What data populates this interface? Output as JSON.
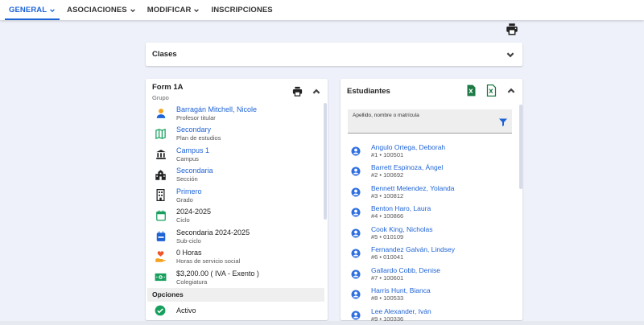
{
  "nav": {
    "tabs": [
      {
        "label": "GENERAL",
        "dropdown": true,
        "active": true
      },
      {
        "label": "ASOCIACIONES",
        "dropdown": true
      },
      {
        "label": "MODIFICAR",
        "dropdown": true
      },
      {
        "label": "INSCRIPCIONES",
        "dropdown": false
      }
    ]
  },
  "clases": {
    "title": "Clases"
  },
  "group": {
    "title": "Form 1A",
    "subtitle": "Grupo",
    "items": [
      {
        "value": "Barragán Mitchell, Nicole",
        "label": "Profesor titular",
        "icon": "person-icon",
        "link": true
      },
      {
        "value": "Secondary",
        "label": "Plan de estudios",
        "icon": "map-icon",
        "link": true
      },
      {
        "value": "Campus 1",
        "label": "Campus",
        "icon": "institution-icon",
        "link": true
      },
      {
        "value": "Secondaria",
        "label": "Sección",
        "icon": "school-icon",
        "link": true
      },
      {
        "value": "Primero",
        "label": "Grado",
        "icon": "building-icon",
        "link": true
      },
      {
        "value": "2024-2025",
        "label": "Ciclo",
        "icon": "calendar-icon",
        "link": false
      },
      {
        "value": "Secondaria 2024-2025",
        "label": "Sub-ciclo",
        "icon": "calendar-event-icon",
        "link": false
      },
      {
        "value": "0 Horas",
        "label": "Horas de servicio social",
        "icon": "volunteer-icon",
        "link": false
      },
      {
        "value": "$3,200.00 ( IVA - Exento )",
        "label": "Colegiatura",
        "icon": "money-icon",
        "link": false
      }
    ],
    "options_title": "Opciones",
    "status": "Activo"
  },
  "students": {
    "title": "Estudiantes",
    "search_label": "Apellido, nombre o matrícula",
    "list": [
      {
        "name": "Angulo Ortega, Deborah",
        "meta": "#1 • 100501"
      },
      {
        "name": "Barrett Espinoza, Ángel",
        "meta": "#2 • 100692"
      },
      {
        "name": "Bennett Melendez, Yolanda",
        "meta": "#3 • 100812"
      },
      {
        "name": "Benton Haro, Laura",
        "meta": "#4 • 100866"
      },
      {
        "name": "Cook King, Nicholas",
        "meta": "#5 • 010109"
      },
      {
        "name": "Fernandez Galván, Lindsey",
        "meta": "#6 • 010041"
      },
      {
        "name": "Gallardo Cobb, Denise",
        "meta": "#7 • 100601"
      },
      {
        "name": "Harris Hunt, Bianca",
        "meta": "#8 • 100533"
      },
      {
        "name": "Lee Alexander, Iván",
        "meta": "#9 • 100336"
      }
    ]
  },
  "colors": {
    "accent": "#1e63d6",
    "green": "#17a05d",
    "orange": "#f4a21c",
    "excel": "#1d7a45"
  }
}
